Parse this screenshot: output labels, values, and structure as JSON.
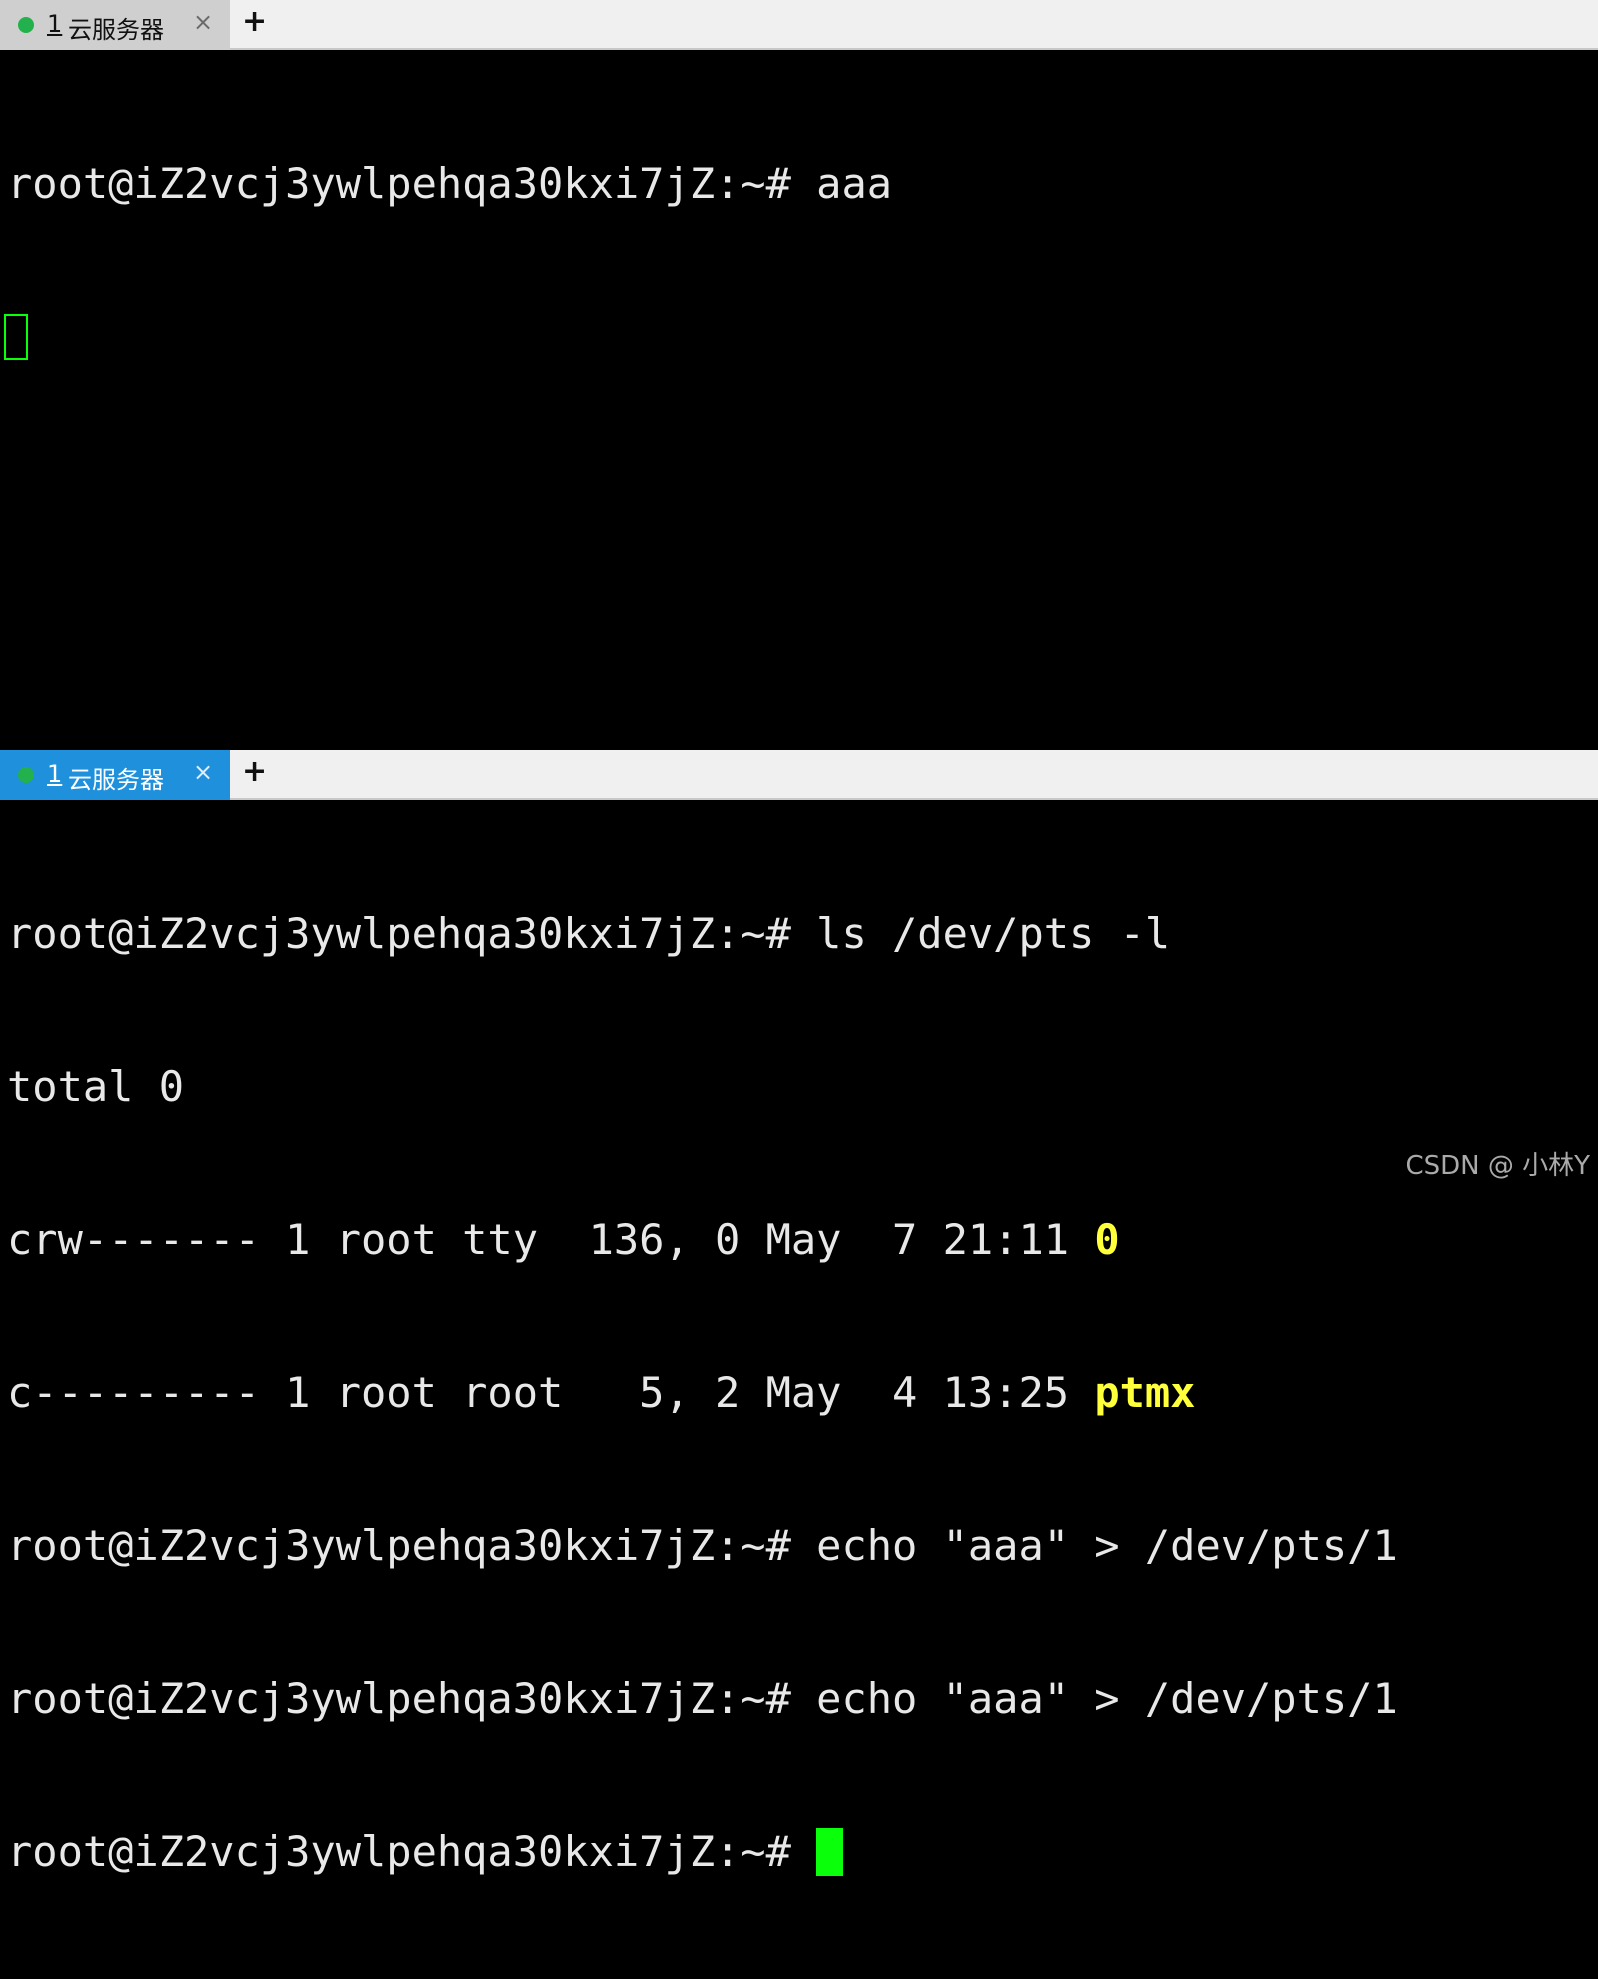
{
  "top_pane": {
    "tab": {
      "number": "1",
      "title": "云服务器",
      "close": "×"
    },
    "new_tab": "+",
    "lines": [
      {
        "prompt": "root@iZ2vcj3ywlpehqa30kxi7jZ:~#",
        "text": " aaa"
      }
    ]
  },
  "bottom_pane": {
    "tab": {
      "number": "1",
      "title": "云服务器",
      "close": "×"
    },
    "new_tab": "+",
    "lines": [
      {
        "prompt": "root@iZ2vcj3ywlpehqa30kxi7jZ:~#",
        "text": " ls /dev/pts -l"
      },
      {
        "text": "total 0"
      },
      {
        "text": "crw------- 1 root tty  136, 0 May  7 21:11 ",
        "highlight": "0"
      },
      {
        "text": "c--------- 1 root root   5, 2 May  4 13:25 ",
        "highlight": "ptmx"
      },
      {
        "prompt": "root@iZ2vcj3ywlpehqa30kxi7jZ:~#",
        "text": " echo \"aaa\" > /dev/pts/1"
      },
      {
        "prompt": "root@iZ2vcj3ywlpehqa30kxi7jZ:~#",
        "text": " echo \"aaa\" > /dev/pts/1"
      },
      {
        "prompt": "root@iZ2vcj3ywlpehqa30kxi7jZ:~#",
        "text": " "
      }
    ]
  },
  "colors": {
    "terminal_bg": "#000000",
    "terminal_fg": "#e8e8e8",
    "cursor": "#0aff0a",
    "highlight": "#ffff3a",
    "active_tab": "#1e90dc",
    "status_dot": "#22b14c"
  },
  "icons": {
    "status": "status-dot-icon",
    "close": "close-icon",
    "new_tab": "plus-icon"
  },
  "watermark": "CSDN @ 小林Y"
}
